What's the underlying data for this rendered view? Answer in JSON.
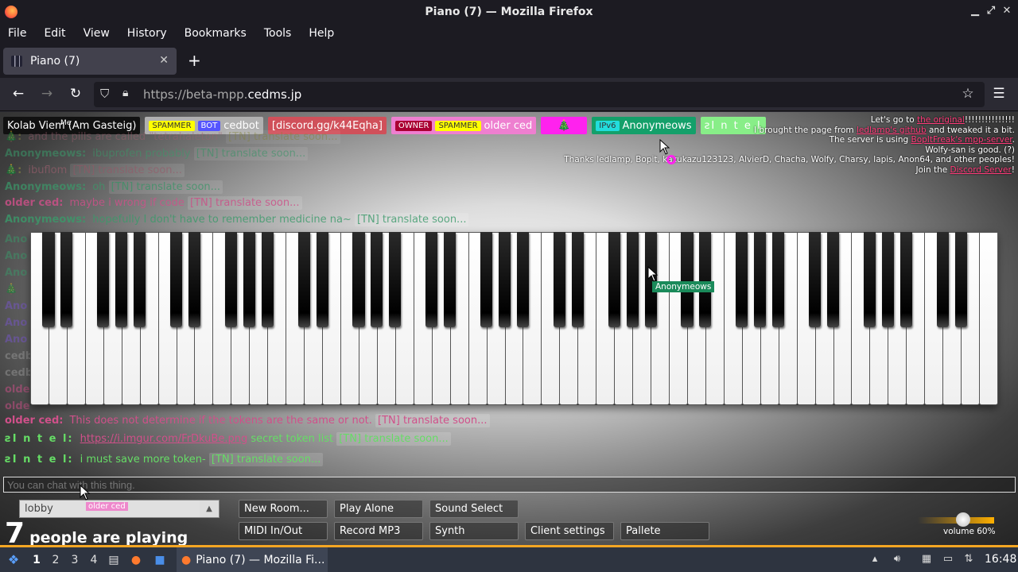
{
  "window": {
    "title": "Piano (7) — Mozilla Firefox"
  },
  "menu": [
    "File",
    "Edit",
    "View",
    "History",
    "Bookmarks",
    "Tools",
    "Help"
  ],
  "tab": {
    "title": "Piano (7)"
  },
  "url": {
    "prefix": "https://beta-mpp.",
    "domain": "cedms.jp"
  },
  "players": [
    {
      "name": "Kolab Viem (Am Gasteig)",
      "meta": "Me",
      "bg": "#111111",
      "fg": "#ffffff",
      "tags": []
    },
    {
      "name": "cedbot",
      "bg": "#b0b0b0",
      "fg": "#ffffff",
      "tags": [
        {
          "label": "SPAMMER",
          "bg": "#ffff00",
          "fg": "#333"
        },
        {
          "label": "BOT",
          "bg": "#5555ff",
          "fg": "#fff"
        }
      ]
    },
    {
      "name": "[discord.gg/k44Eqha]",
      "bg": "#d0505a",
      "fg": "#ffffff",
      "tags": []
    },
    {
      "name": "older ced",
      "bg": "#ee7fd0",
      "fg": "#ffffff",
      "tags": [
        {
          "label": "OWNER",
          "bg": "#aa0033",
          "fg": "#fff"
        },
        {
          "label": "SPAMMER",
          "bg": "#ffff00",
          "fg": "#333"
        }
      ]
    },
    {
      "name": "🎄",
      "bg": "#ff22ee",
      "fg": "#ffffff",
      "tags": []
    },
    {
      "name": "Anonymeows",
      "bg": "#14a06a",
      "fg": "#ffffff",
      "tags": [
        {
          "label": "IPv6",
          "bg": "#22dddd",
          "fg": "#333"
        }
      ]
    },
    {
      "name": "ꙅI n t e l",
      "bg": "#88ee88",
      "fg": "#ffffff",
      "tags": []
    }
  ],
  "credits": {
    "l1_a": "Let's go to ",
    "l1_link": "the original",
    "l1_b": "!!!!!!!!!!!!!!!",
    "l2_a": "I brought the page from ",
    "l2_link": "ledlamp's github",
    "l2_b": " and tweaked it a bit.",
    "l3_a": "The server is using ",
    "l3_link": "BopItFreak's mpp-server",
    "l4": "Wolfy-san is good. (?)",
    "l5": "Thanks ledlamp, Bopit, kazukazu123123, AlvierD, Chacha, Wolfy, Charsy, lapis, Anon64, and other peoples!",
    "l6_a": "Join the ",
    "l6_link": "Discord Server",
    "l6_b": "!"
  },
  "chat": [
    {
      "name": "🎄:",
      "text": "and the pills are called \"tetrahaleton\"",
      "tn": "[TN] translate soon...",
      "color": "#8a8a40"
    },
    {
      "name": "Anonymeows:",
      "text": "ibuprofen probably",
      "tn": "[TN] translate soon...",
      "color": "#3a9a6a"
    },
    {
      "name": "🎄:",
      "text": "ibuflom",
      "tn": "[TN] translate soon...",
      "color": "#a06070"
    },
    {
      "name": "Anonymeows:",
      "text": "oh",
      "tn": "[TN] translate soon...",
      "color": "#3a9a6a"
    },
    {
      "name": "older ced:",
      "text": "maybe i wrong if code",
      "tn": "[TN] translate soon...",
      "color": "#d0508a"
    },
    {
      "name": "Anonymeows:",
      "text": "hopefully I don't have to remember medicine na~",
      "tn": "[TN] translate soon...",
      "color": "#3a9a6a"
    },
    {
      "name": "older ced:",
      "text": "This does not determine if the tokens are the same or not.",
      "tn": "[TN] translate soon...",
      "color": "#d0508a"
    },
    {
      "name": "ꙅI n t e l:",
      "link": "https://i.imgur.com/FrDkuBe.png",
      "text": " secret token list",
      "tn": "[TN] translate soon...",
      "color": "#66dd66"
    },
    {
      "name": "ꙅI n t e l:",
      "text": "i must save more token-",
      "tn": "[TN] translate soon...",
      "color": "#66dd66"
    }
  ],
  "cursor_label": "Anonymeows",
  "chat_input": {
    "placeholder": "You can chat with this thing."
  },
  "lobby": {
    "value": "lobby",
    "tag": "older ced"
  },
  "people": {
    "count": "7",
    "label": "people are playing"
  },
  "buttons": {
    "new_room": "New Room...",
    "play_alone": "Play Alone",
    "sound_select": "Sound Select",
    "midi": "MIDI In/Out",
    "record": "Record MP3",
    "synth": "Synth",
    "client_settings": "Client settings",
    "pallete": "Pallete"
  },
  "volume": {
    "label": "volume 60%",
    "level": 0.6
  },
  "taskbar": {
    "workspaces": [
      "1",
      "2",
      "3",
      "4"
    ],
    "app_title": "Piano (7) — Mozilla Fi...",
    "clock": "16:48"
  }
}
